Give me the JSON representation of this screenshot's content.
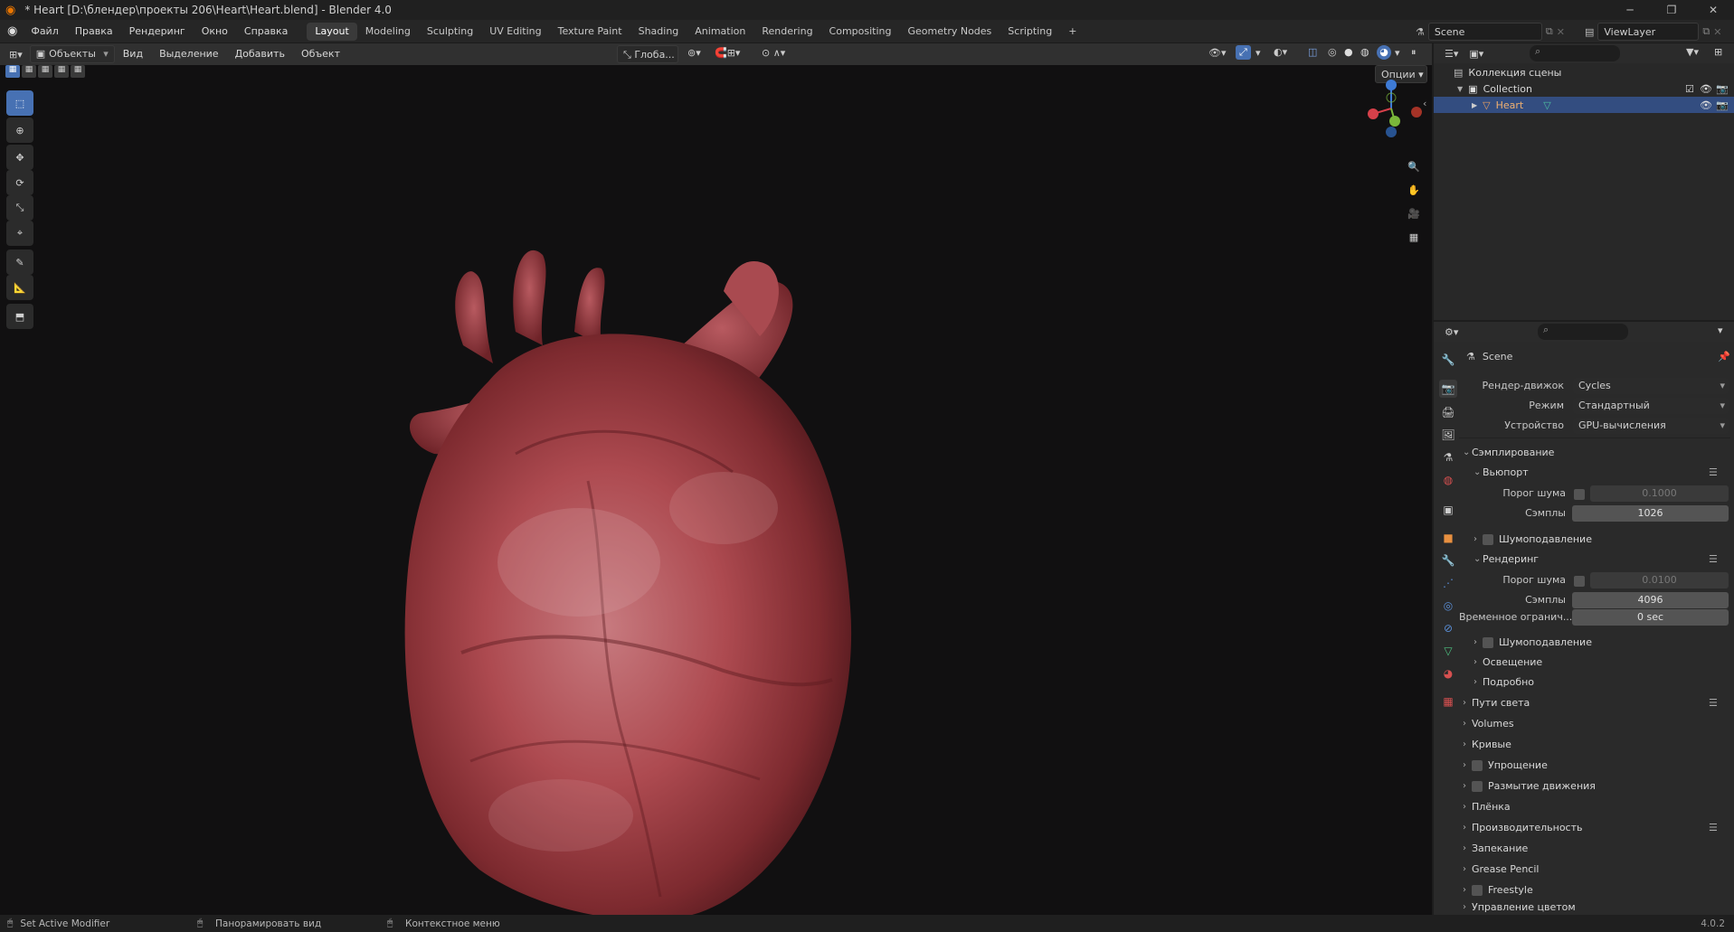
{
  "window": {
    "title": "* Heart [D:\\блендер\\проекты 206\\Heart\\Heart.blend] - Blender 4.0",
    "minimize_icon": "minimize-icon",
    "maximize_icon": "restore-icon",
    "close_icon": "close-icon"
  },
  "menubar": {
    "items": [
      "Файл",
      "Правка",
      "Рендеринг",
      "Окно",
      "Справка"
    ],
    "workspaces": [
      "Layout",
      "Modeling",
      "Sculpting",
      "UV Editing",
      "Texture Paint",
      "Shading",
      "Animation",
      "Rendering",
      "Compositing",
      "Geometry Nodes",
      "Scripting"
    ],
    "active_workspace": "Layout",
    "add_workspace": "+",
    "scene_label": "Scene",
    "viewlayer_label": "ViewLayer"
  },
  "viewport_header": {
    "mode": "Объекты",
    "menus": [
      "Вид",
      "Выделение",
      "Добавить",
      "Объект"
    ],
    "orientation": "Глоба...",
    "options_label": "Опции"
  },
  "outliner": {
    "scene_collection": "Коллекция сцены",
    "collection": "Collection",
    "object": "Heart"
  },
  "properties": {
    "context_title": "Scene",
    "render_engine_label": "Рендер-движок",
    "render_engine_value": "Cycles",
    "mode_label": "Режим",
    "mode_value": "Стандартный",
    "device_label": "Устройство",
    "device_value": "GPU-вычисления",
    "sampling": "Сэмплирование",
    "viewport": "Вьюпорт",
    "noise_threshold_label": "Порог шума",
    "viewport_noise_threshold": "0.1000",
    "samples_label": "Сэмплы",
    "viewport_samples": "1026",
    "denoise": "Шумоподавление",
    "render": "Рендеринг",
    "render_noise_threshold": "0.0100",
    "render_samples": "4096",
    "time_limit_label": "Временное огранич...",
    "time_limit_value": "0 sec",
    "lighting": "Освещение",
    "advanced": "Подробно",
    "sections": [
      "Пути света",
      "Volumes",
      "Кривые",
      "Упрощение",
      "Размытие движения",
      "Плёнка",
      "Производительность",
      "Запекание",
      "Grease Pencil",
      "Freestyle",
      "Управление цветом"
    ]
  },
  "statusbar": {
    "left": "Set Active Modifier",
    "middle": "Панорамировать вид",
    "right": "Контекстное меню",
    "version": "4.0.2"
  }
}
